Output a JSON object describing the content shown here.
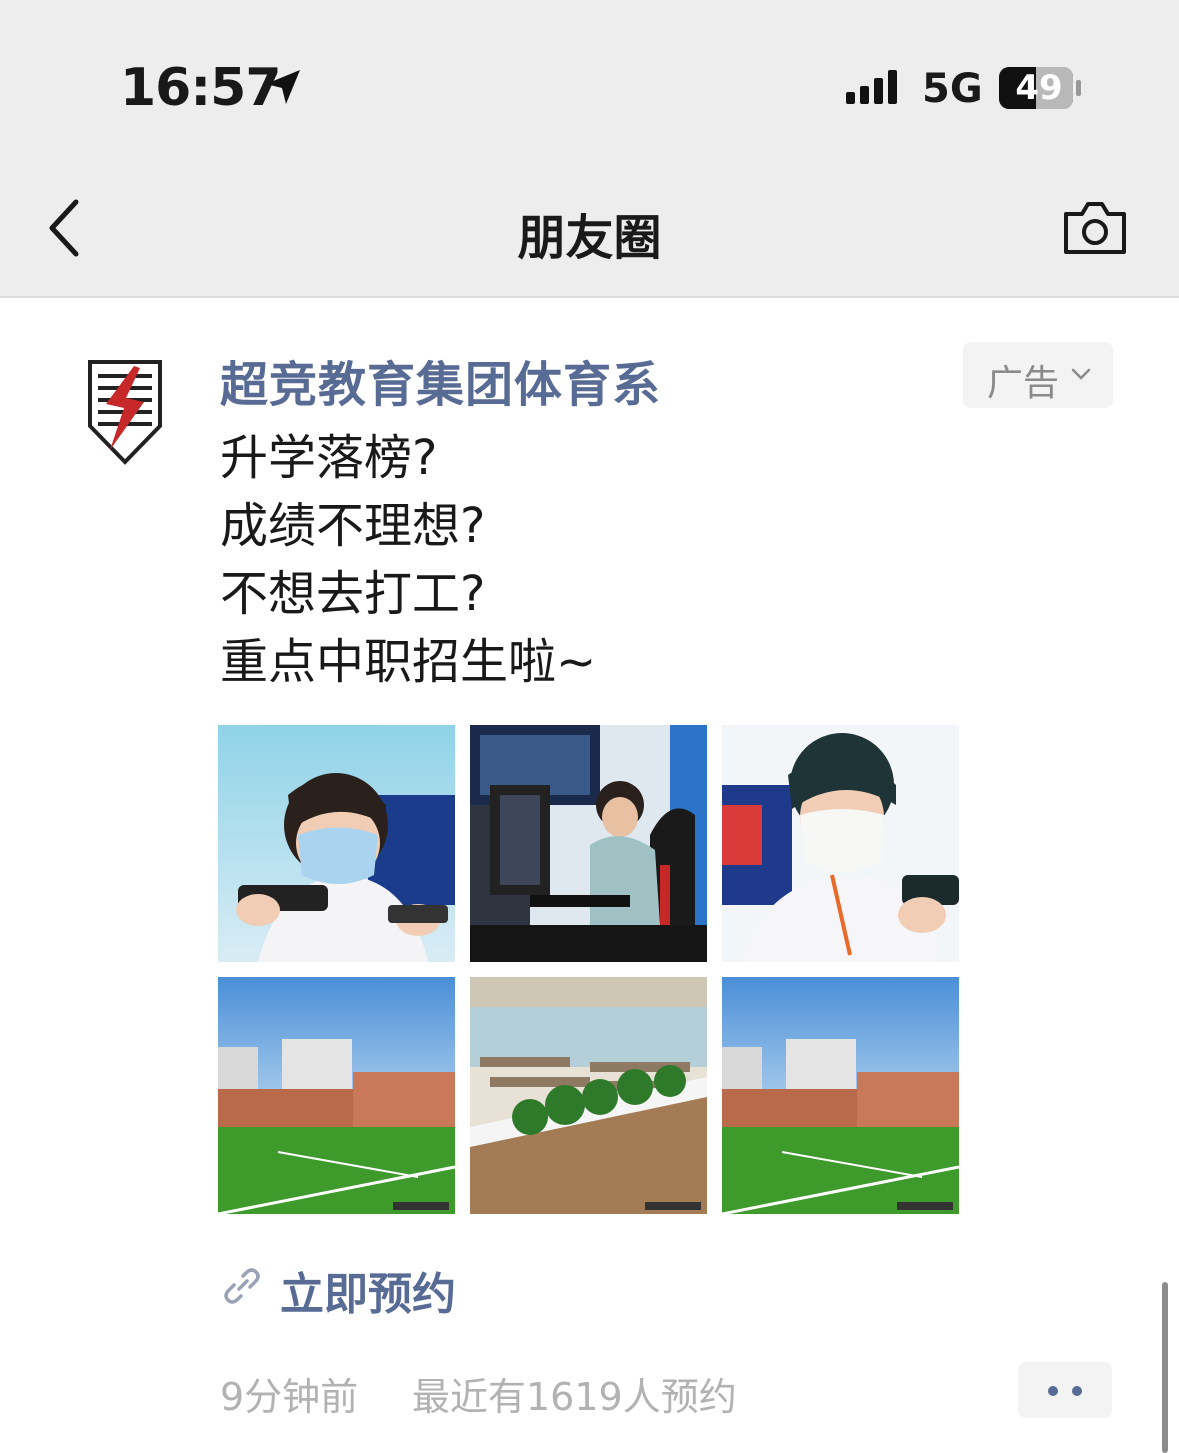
{
  "status_bar": {
    "time": "16:57",
    "network": "5G",
    "battery": "49"
  },
  "nav": {
    "title": "朋友圈"
  },
  "post": {
    "author": "超竞教育集团体育系",
    "ad_label": "广告",
    "text_lines": [
      "升学落榜?",
      "成绩不理想?",
      "不想去打工?",
      "重点中职招生啦~"
    ],
    "images": [
      {
        "icon": "student-playing-mobile-photo"
      },
      {
        "icon": "esports-lab-photo"
      },
      {
        "icon": "student-with-phone-photo"
      },
      {
        "icon": "campus-football-field-photo"
      },
      {
        "icon": "canteen-photo"
      },
      {
        "icon": "campus-football-field-photo"
      }
    ],
    "cta_label": "立即预约",
    "time_ago": "9分钟前",
    "reservation_info": "最近有1619人预约"
  },
  "colors": {
    "link_blue": "#576b95",
    "header_bg": "#ededed",
    "meta_gray": "#b2b2b2"
  }
}
